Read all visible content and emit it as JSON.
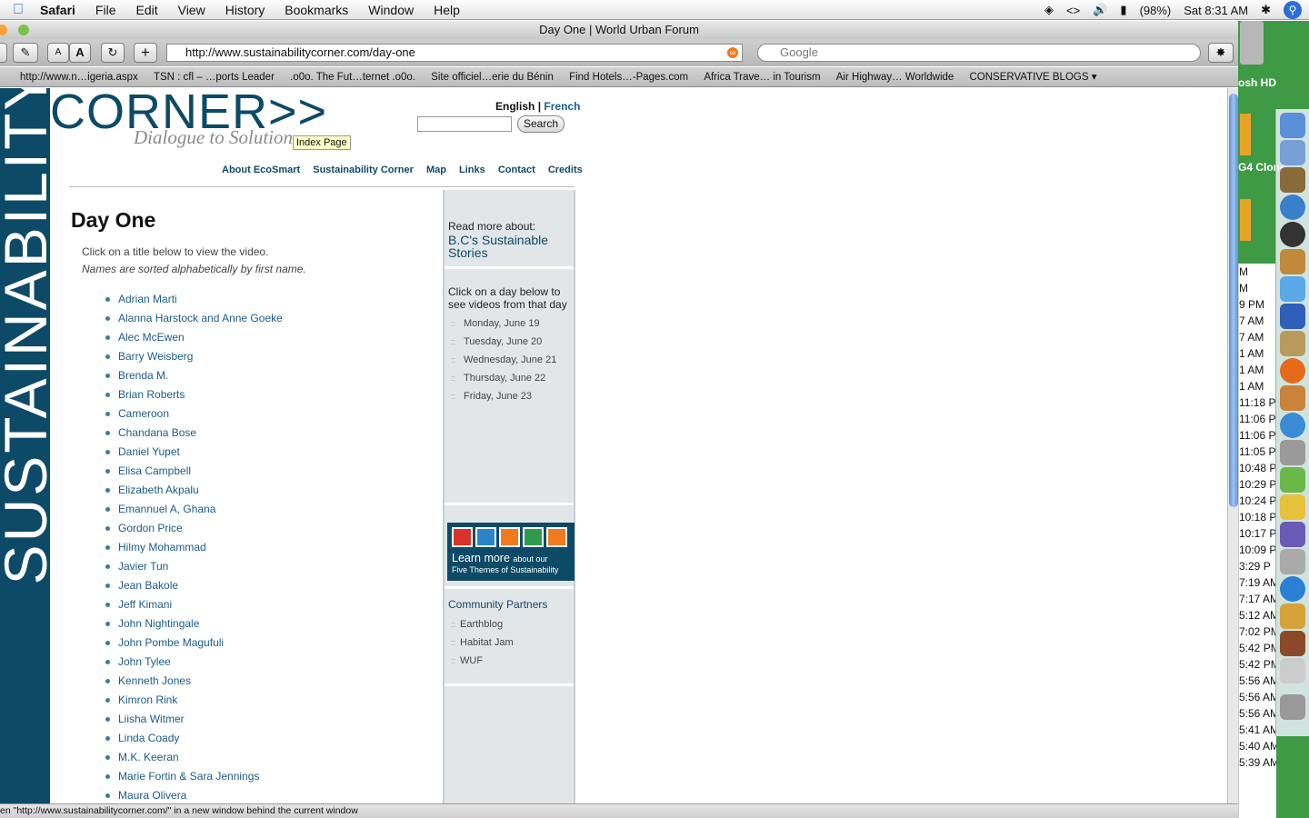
{
  "menubar": {
    "apple": "",
    "app": "Safari",
    "menus": [
      "File",
      "Edit",
      "View",
      "History",
      "Bookmarks",
      "Window",
      "Help"
    ],
    "battery": "(98%)",
    "clock": "Sat 8:31 AM"
  },
  "window": {
    "title": "Day One | World Urban Forum"
  },
  "toolbar": {
    "text_small": "A",
    "text_large": "A",
    "reload": "C",
    "add": "+",
    "url": "http://www.sustainabilitycorner.com/day-one",
    "search_placeholder": "Google"
  },
  "bookmarks": [
    "http://www.n…igeria.aspx",
    "TSN : cfl – …ports Leader",
    ".o0o. The Fut…ternet .o0o.",
    "Site officiel…erie du Bénin",
    "Find Hotels…-Pages.com",
    "Africa Trave… in Tourism",
    "Air Highway… Worldwide",
    "CONSERVATIVE BLOGS ▾"
  ],
  "page": {
    "vertical_brand": "SUSTAINABILITY",
    "logo": "CORNER>>",
    "tagline": "Dialogue to Solution",
    "tooltip": "Index Page",
    "lang_english": "English",
    "lang_sep": "|",
    "lang_french": "French",
    "search_button": "Search",
    "nav": [
      "About EcoSmart",
      "Sustainability Corner",
      "Map",
      "Links",
      "Contact",
      "Credits"
    ],
    "title": "Day One",
    "intro": "Click on a title below to view the video.",
    "note": "Names are sorted alphabetically by first name.",
    "speakers": [
      "Adrian Marti",
      "Alanna Harstock and Anne Goeke",
      "Alec McEwen",
      "Barry Weisberg",
      "Brenda M.",
      "Brian Roberts",
      "Cameroon",
      "Chandana Bose",
      "Daniel Yupet",
      "Elisa Campbell",
      "Elizabeth Akpalu",
      "Emannuel A, Ghana",
      "Gordon Price",
      "Hilmy Mohammad",
      "Javier Tun",
      "Jean Bakole",
      "Jeff Kimani",
      "John Nightingale",
      "John Pombe Magufuli",
      "John Tylee",
      "Kenneth Jones",
      "Kimron Rink",
      "Liisha Witmer",
      "Linda Coady",
      "M.K. Keeran",
      "Marie Fortin & Sara Jennings",
      "Maura Olivera"
    ]
  },
  "rightcol": {
    "readmore_label": "Read more about:",
    "readmore_link": "B.C's Sustainable Stories",
    "days_intro": "Click on a day below to see videos from that day",
    "days": [
      "Monday, June 19",
      "Tuesday, June 20",
      "Wednesday, June 21",
      "Thursday, June 22",
      "Friday, June 23"
    ],
    "themes_title": "Learn more",
    "themes_title_small": "about our",
    "themes_sub": "Five Themes of Sustainability",
    "partners_title": "Community Partners",
    "partners": [
      "Earthblog",
      "Habitat Jam",
      "WUF"
    ]
  },
  "status": "en \"http://www.sustainabilitycorner.com/\" in a new window behind the current window",
  "desktop": {
    "hd_label": "osh HD",
    "hd2_label": "G4 Clone",
    "list_times": [
      "M",
      "M",
      "9 PM",
      "7 AM",
      "7 AM",
      "1 AM",
      "1 AM",
      "1 AM",
      "11:18 P",
      "11:06 P",
      "11:06 P",
      "11:05 P",
      "10:48 P",
      "10:29 P",
      "10:24 P",
      "10:18 P",
      "10:17 P",
      "10:09 P",
      "3:29 P",
      "7:19 AM",
      "7:17 AM",
      "5:12 AM",
      "7:02 PM",
      "5:42 PM",
      "5:42 PM",
      "5:56 AM",
      "5:56 AM",
      "5:56 AM",
      "5:41 AM",
      "5:40 AM",
      "5:39 AM"
    ]
  },
  "colors": {
    "brand": "#0d4a67",
    "link": "#1a5c8a",
    "accent_orange": "#f07a1e"
  }
}
